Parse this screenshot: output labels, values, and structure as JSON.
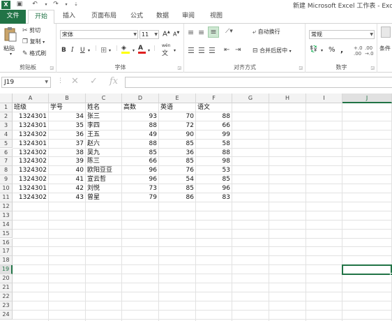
{
  "window": {
    "title": "新建 Microsoft Excel 工作表 - Exce",
    "app_logo": "X",
    "qat": [
      "save-icon",
      "undo-icon",
      "redo-icon",
      "customize-icon"
    ]
  },
  "tabs": [
    {
      "label": "文件"
    },
    {
      "label": "开始"
    },
    {
      "label": "插入"
    },
    {
      "label": "页面布局"
    },
    {
      "label": "公式"
    },
    {
      "label": "数据"
    },
    {
      "label": "审阅"
    },
    {
      "label": "视图"
    }
  ],
  "ribbon": {
    "clipboard": {
      "label": "剪贴板",
      "paste": "粘贴",
      "cut": "剪切",
      "copy": "复制",
      "painter": "格式刷"
    },
    "font": {
      "label": "字体",
      "name": "宋体",
      "size": "11",
      "bold": "B",
      "italic": "I",
      "underline": "U",
      "grow": "A",
      "shrink": "A",
      "wen": "wén"
    },
    "align": {
      "label": "对齐方式",
      "wrap": "自动换行",
      "merge": "合并后居中"
    },
    "number": {
      "label": "数字",
      "format": "常规",
      "percent": "%",
      "comma": ","
    },
    "styles": {
      "label": "条件"
    }
  },
  "formula_bar": {
    "name_box": "J19",
    "fx": "fx",
    "formula": ""
  },
  "colors": {
    "accent": "#217346"
  },
  "grid": {
    "columns": [
      "A",
      "B",
      "C",
      "D",
      "E",
      "F",
      "G",
      "H",
      "I",
      "J"
    ],
    "selected_column": "J",
    "selected_row": 19,
    "rows": [
      "1",
      "2",
      "3",
      "4",
      "5",
      "6",
      "7",
      "8",
      "9",
      "10",
      "11",
      "12",
      "13",
      "14",
      "15",
      "16",
      "17",
      "18",
      "19",
      "20",
      "21",
      "22",
      "23",
      "24"
    ],
    "header": [
      "班级",
      "学号",
      "姓名",
      "高数",
      "英语",
      "语文"
    ],
    "data": [
      [
        "1324301",
        "34",
        "张三",
        "93",
        "70",
        "88"
      ],
      [
        "1324301",
        "35",
        "李四",
        "88",
        "72",
        "66"
      ],
      [
        "1324302",
        "36",
        "王五",
        "49",
        "90",
        "99"
      ],
      [
        "1324301",
        "37",
        "赵六",
        "88",
        "85",
        "58"
      ],
      [
        "1324302",
        "38",
        "吴九",
        "85",
        "36",
        "88"
      ],
      [
        "1324302",
        "39",
        "陈三",
        "66",
        "85",
        "98"
      ],
      [
        "1324302",
        "40",
        "欧阳豆豆",
        "96",
        "76",
        "53"
      ],
      [
        "1324302",
        "41",
        "宣云哲",
        "96",
        "54",
        "85"
      ],
      [
        "1324301",
        "42",
        "刘悦",
        "73",
        "85",
        "96"
      ],
      [
        "1324302",
        "43",
        "曾星",
        "79",
        "86",
        "83"
      ]
    ]
  }
}
